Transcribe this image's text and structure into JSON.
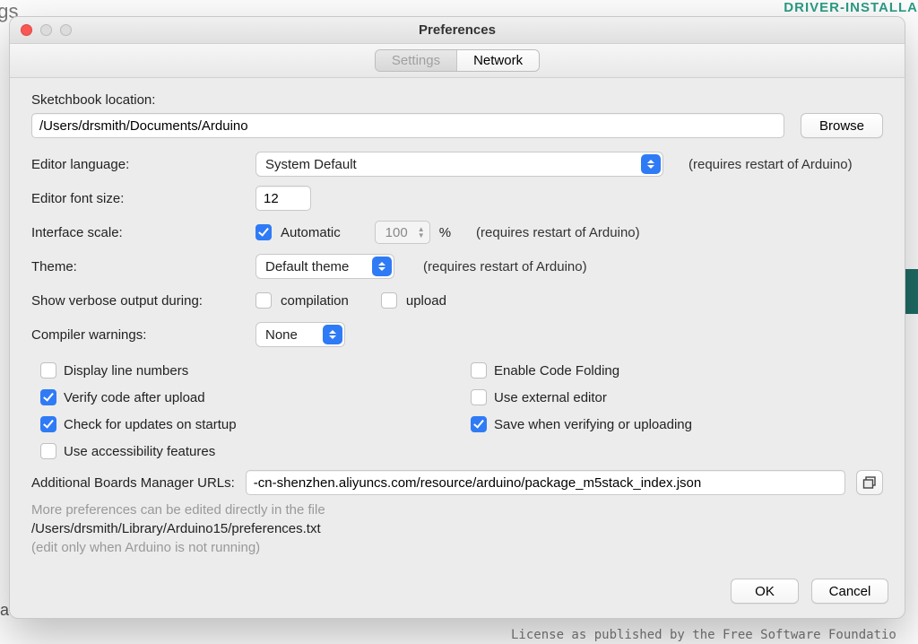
{
  "window": {
    "title": "Preferences",
    "tabs": {
      "settings": "Settings",
      "network": "Network"
    }
  },
  "labels": {
    "sketchbook_location": "Sketchbook location:",
    "editor_language": "Editor language:",
    "editor_font_size": "Editor font size:",
    "interface_scale": "Interface scale:",
    "theme": "Theme:",
    "verbose": "Show verbose output during:",
    "compiler_warnings": "Compiler warnings:",
    "boards_urls": "Additional Boards Manager URLs:"
  },
  "values": {
    "sketchbook_path": "/Users/drsmith/Documents/Arduino",
    "browse": "Browse",
    "language": "System Default",
    "restart_note": "(requires restart of Arduino)",
    "font_size": "12",
    "auto_scale_label": "Automatic",
    "scale_value": "100",
    "percent": "%",
    "theme": "Default theme",
    "compilation": "compilation",
    "upload": "upload",
    "warnings": "None",
    "boards_url_value": "-cn-shenzhen.aliyuncs.com/resource/arduino/package_m5stack_index.json"
  },
  "checks": {
    "display_line_numbers": "Display line numbers",
    "verify_after_upload": "Verify code after upload",
    "check_updates": "Check for updates on startup",
    "use_accessibility": "Use accessibility features",
    "enable_code_folding": "Enable Code Folding",
    "use_external_editor": "Use external editor",
    "save_when_verifying": "Save when verifying or uploading"
  },
  "more": {
    "line1": "More preferences can be edited directly in the file",
    "path": "/Users/drsmith/Library/Arduino15/preferences.txt",
    "line2": "(edit only when Arduino is not running)"
  },
  "buttons": {
    "ok": "OK",
    "cancel": "Cancel"
  },
  "backdrop": {
    "top_left": "ngs",
    "top_right": "DRIVER-INSTALLA",
    "footer": "License as published by the Free Software Foundatio"
  }
}
